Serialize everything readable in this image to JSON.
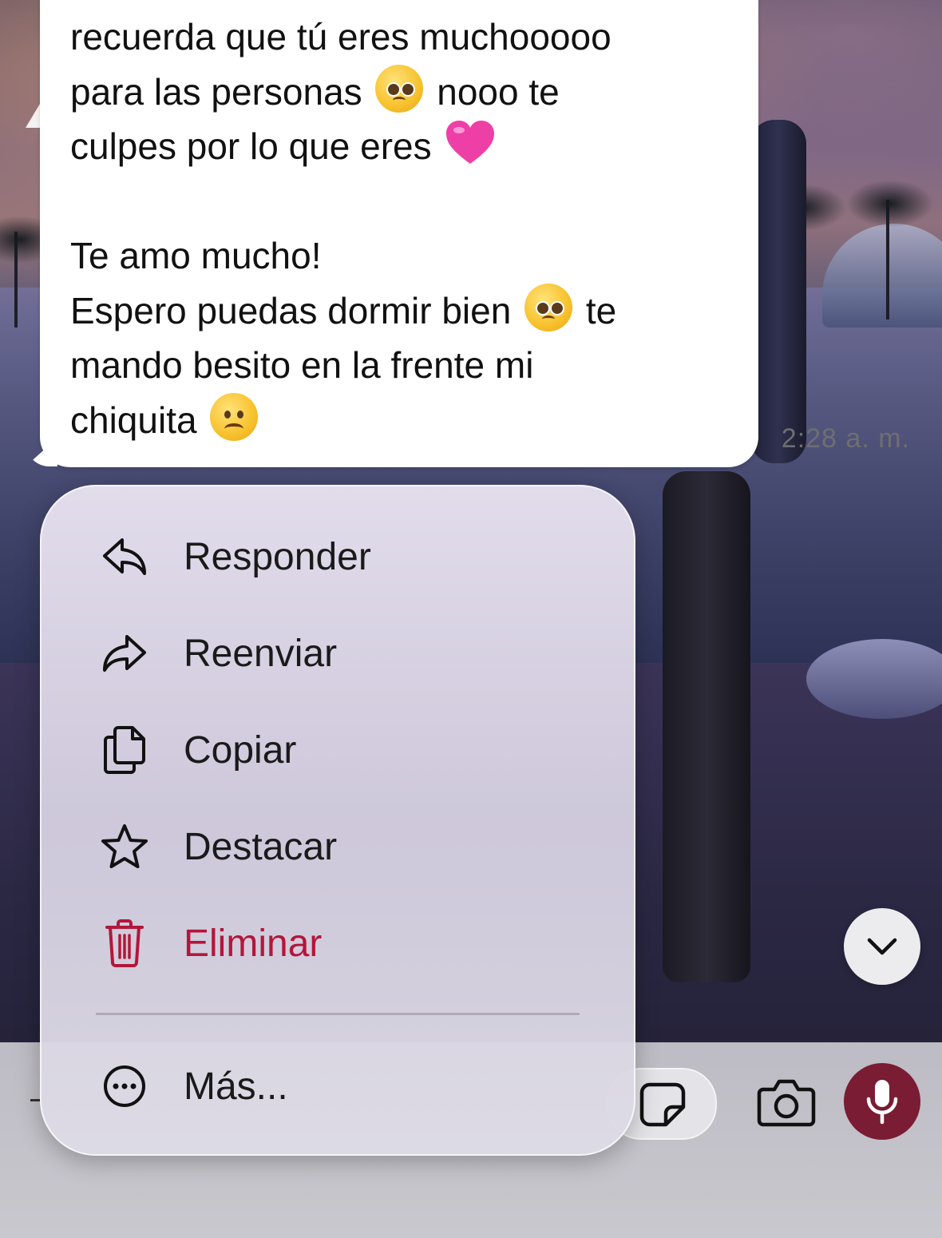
{
  "message": {
    "lines": [
      {
        "text": "recuerda que tú eres muchooooo",
        "emoji": ""
      },
      {
        "text": "para las personas",
        "emoji": "pleading-face",
        "after": "nooo te"
      },
      {
        "text": "culpes por lo que eres",
        "emoji": "pink-heart",
        "after": ""
      },
      {
        "text": "",
        "emoji": "",
        "after": ""
      },
      {
        "text": "Te amo mucho!",
        "emoji": "",
        "after": ""
      },
      {
        "text": "Espero puedas dormir bien",
        "emoji": "pleading-face",
        "after": "te"
      },
      {
        "text": "mando besito en la frente mi",
        "emoji": "",
        "after": ""
      },
      {
        "text": "chiquita",
        "emoji": "frowning-face",
        "after": ""
      }
    ],
    "time": "2:28 a. m."
  },
  "context_menu": {
    "items": [
      {
        "label": "Responder",
        "icon": "reply-icon"
      },
      {
        "label": "Reenviar",
        "icon": "forward-icon"
      },
      {
        "label": "Copiar",
        "icon": "copy-icon"
      },
      {
        "label": "Destacar",
        "icon": "star-icon"
      },
      {
        "label": "Eliminar",
        "icon": "trash-icon",
        "destructive": true
      }
    ],
    "more": {
      "label": "Más...",
      "icon": "more-icon"
    }
  },
  "colors": {
    "destructive": "#b3163a",
    "mic_button": "#7a1c33"
  }
}
